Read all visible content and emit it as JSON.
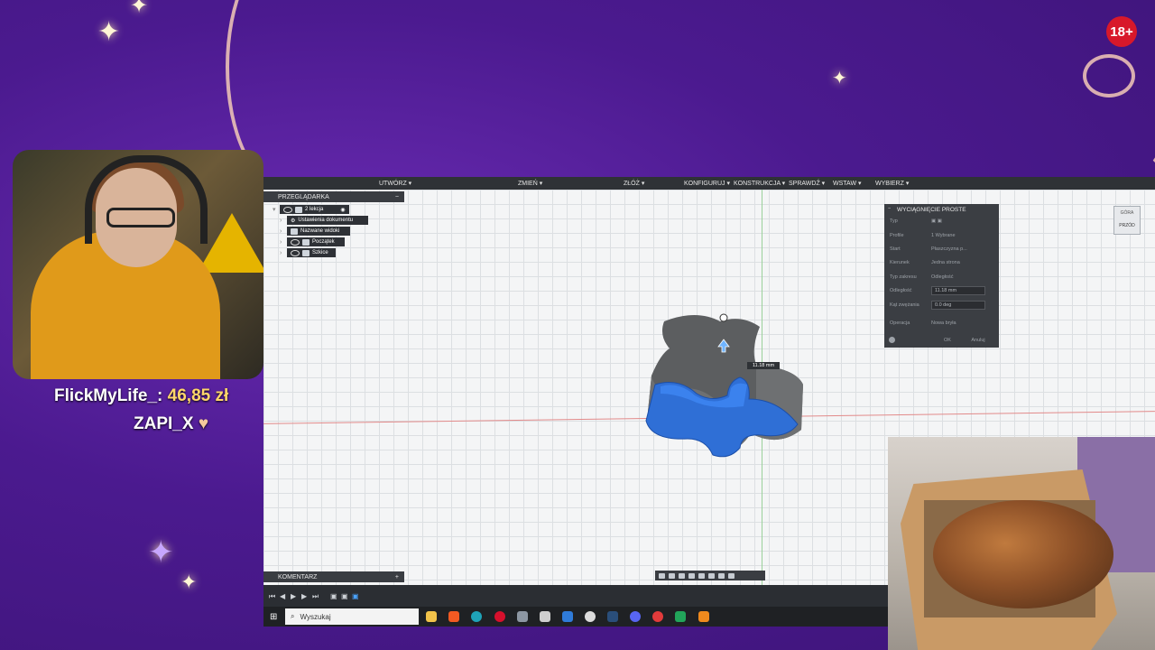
{
  "overlay": {
    "age_badge": "18+",
    "donations": [
      {
        "name": "FlickMyLife_:",
        "amount": "46,85 zł"
      },
      {
        "name": "ZAPI_X",
        "heart": "♥"
      }
    ]
  },
  "fusion": {
    "toolbar": [
      "UTWÓRZ ▾",
      "ZMIEŃ ▾",
      "ZŁÓŻ ▾",
      "KONFIGURUJ ▾",
      "KONSTRUKCJA ▾",
      "SPRAWDŹ ▾",
      "WSTAW ▾",
      "WYBIERZ ▾"
    ],
    "browser": {
      "title": "PRZEGLĄDARKA",
      "root": "2 lekcja",
      "items": [
        "Ustawienia dokumentu",
        "Nazwane widoki",
        "Początek",
        "Szkice"
      ]
    },
    "comments": {
      "title": "KOMENTARZ",
      "add": "+"
    },
    "dimension": "11.18 mm",
    "dialog": {
      "title": "WYCIĄGNIĘCIE PROSTE",
      "rows": [
        {
          "label": "Typ",
          "value": ""
        },
        {
          "label": "Profile",
          "value": "1 Wybrane"
        },
        {
          "label": "Start",
          "value": "Płaszczyzna p..."
        },
        {
          "label": "Kierunek",
          "value": "Jedna strona"
        },
        {
          "label": "Typ zakresu",
          "value": "Odległość"
        },
        {
          "label": "Odległość",
          "value": "11.18 mm"
        },
        {
          "label": "Kąt zwężania",
          "value": "0.0 deg"
        },
        {
          "label": "Operacja",
          "value": "Nowa bryła"
        }
      ],
      "ok": "OK",
      "cancel": "Anuluj"
    },
    "viewcube": {
      "top": "GÓRA",
      "front": "PRZÓD"
    }
  },
  "taskbar": {
    "search_placeholder": "Wyszukaj",
    "icons": [
      "windows-icon",
      "explorer-icon",
      "brave-icon",
      "edge-icon",
      "opera-icon",
      "misc-icon",
      "app-icon",
      "app2-icon",
      "obs-icon",
      "steam-icon",
      "discord-icon",
      "app3-icon",
      "sheets-icon",
      "fusion-icon"
    ]
  },
  "colors": {
    "background": "#4b1a8f",
    "accent_gold": "#ffd66b",
    "extrude_blue": "#2f6fd6",
    "body_gray": "#5a5c5e"
  }
}
